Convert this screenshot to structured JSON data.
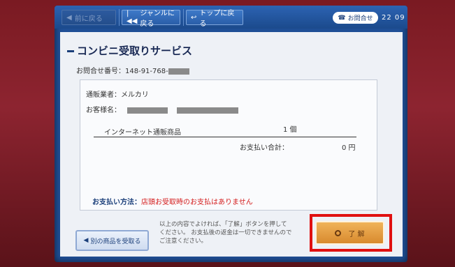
{
  "topbar": {
    "back_label": "前に戻る",
    "genre_label": "ジャンルに戻る",
    "top_label": "トップに戻る",
    "inquiry_label": "お問合せ",
    "clock": "22 09"
  },
  "main": {
    "title": "コンビニ受取りサービス",
    "inquiry_no_label": "お問合せ番号：",
    "inquiry_no_value": "148-91-768-",
    "merchant_label": "通販業者：",
    "merchant_value": "メルカリ",
    "customer_label": "お客様名：",
    "item_name": "インターネット通販商品",
    "item_qty": "1 個",
    "total_label": "お支払い合計：",
    "total_value": "0 円",
    "payment_method_label": "お支払い方法：",
    "payment_method_value": "店頭お受取時のお支払はありません"
  },
  "footer": {
    "other_item_button": "別の商品を受取る",
    "notice_line1": "以上の内容でよければ、「了解」ボタンを押して",
    "notice_line2": "ください。 お支払後の返金は一切できませんので",
    "notice_line3": "ご注意ください。",
    "ok_button": "了 解"
  },
  "colors": {
    "accent_blue": "#1f4f96",
    "ok_orange": "#e09a3d",
    "highlight_red": "#e01010",
    "payment_red": "#d41c1c"
  }
}
